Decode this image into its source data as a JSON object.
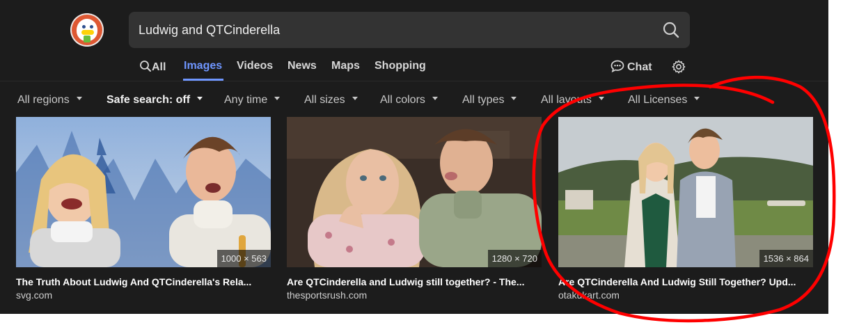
{
  "search": {
    "query": "Ludwig and QTCinderella"
  },
  "tabs": [
    {
      "label": "All",
      "icon": "search-icon"
    },
    {
      "label": "Images"
    },
    {
      "label": "Videos"
    },
    {
      "label": "News"
    },
    {
      "label": "Maps"
    },
    {
      "label": "Shopping"
    }
  ],
  "active_tab": "Images",
  "chat_label": "Chat",
  "filters": [
    {
      "label": "All regions"
    },
    {
      "label": "Safe search: off"
    },
    {
      "label": "Any time"
    },
    {
      "label": "All sizes"
    },
    {
      "label": "All colors"
    },
    {
      "label": "All types"
    },
    {
      "label": "All layouts"
    },
    {
      "label": "All Licenses"
    }
  ],
  "results": [
    {
      "title": "The Truth About Ludwig And QTCinderella's Rela...",
      "source": "svg.com",
      "dimensions": "1000 × 563"
    },
    {
      "title": "Are QTCinderella and Ludwig still together? - The...",
      "source": "thesportsrush.com",
      "dimensions": "1280 × 720"
    },
    {
      "title": "Are QTCinderella And Ludwig Still Together? Upd...",
      "source": "otakukart.com",
      "dimensions": "1536 × 864"
    }
  ],
  "colors": {
    "background": "#1c1c1c",
    "search_bg": "#333333",
    "accent": "#6f96ff",
    "logo": "#de5833",
    "annotation": "#ff0000"
  }
}
